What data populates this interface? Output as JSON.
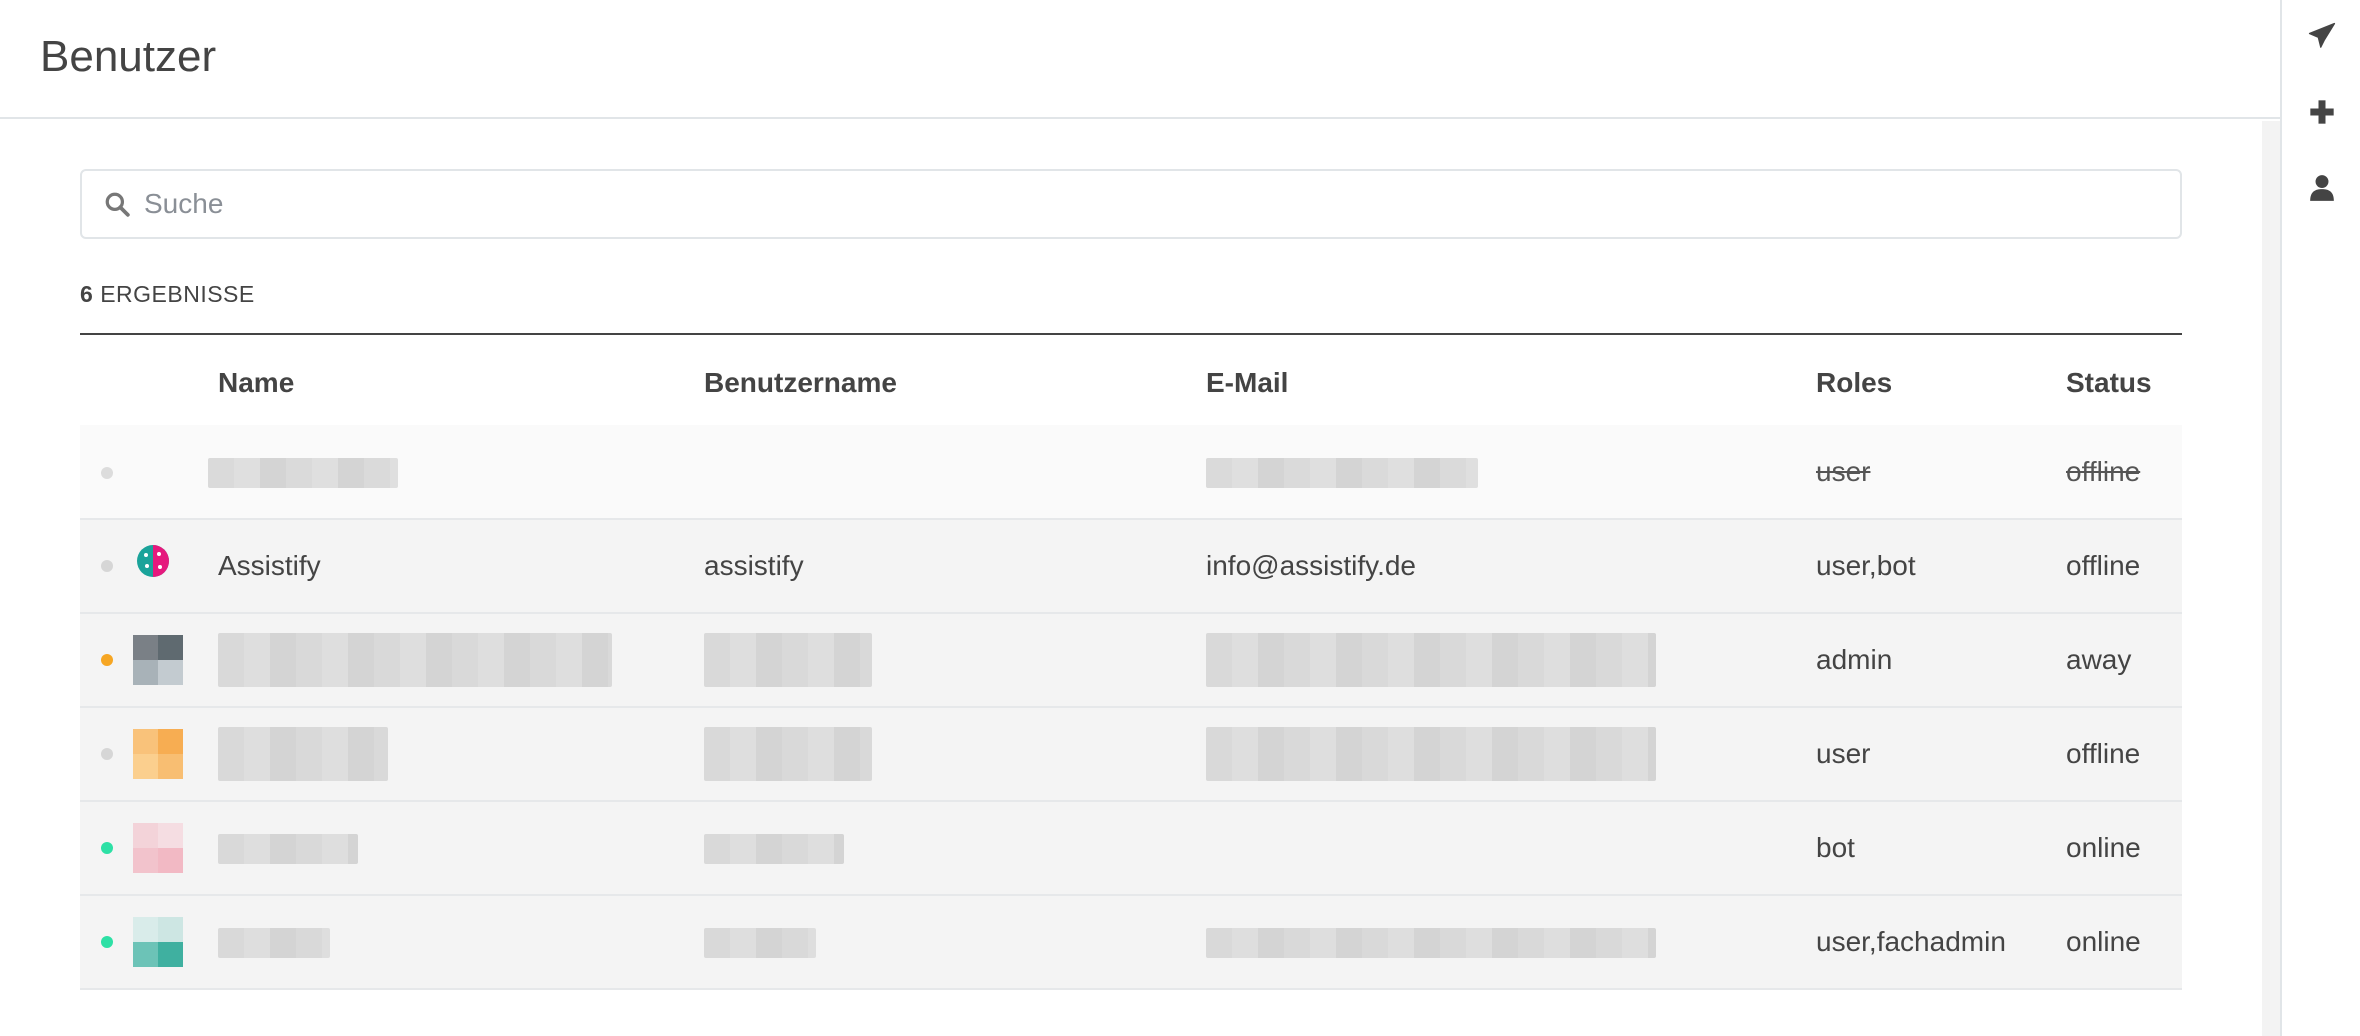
{
  "header": {
    "title": "Benutzer"
  },
  "search": {
    "placeholder": "Suche"
  },
  "results": {
    "count": "6",
    "label": "ERGEBNISSE"
  },
  "table": {
    "columns": [
      "Name",
      "Benutzername",
      "E-Mail",
      "Roles",
      "Status"
    ],
    "rows": [
      {
        "name": "",
        "username": "",
        "email": "",
        "roles": "user",
        "status": "offline",
        "status_color": "#d6d6d6",
        "deactivated": true
      },
      {
        "name": "Assistify",
        "username": "assistify",
        "email": "info@assistify.de",
        "roles": "user,bot",
        "status": "offline",
        "status_color": "#d6d6d6",
        "avatar": "assistify-logo"
      },
      {
        "name": "",
        "username": "",
        "email": "",
        "roles": "admin",
        "status": "away",
        "status_color": "#f6a623",
        "avatar_color": "#5f6a70"
      },
      {
        "name": "",
        "username": "",
        "email": "",
        "roles": "user",
        "status": "offline",
        "status_color": "#d6d6d6",
        "avatar_color": "#f7ad52"
      },
      {
        "name": "",
        "username": "",
        "email": "",
        "roles": "bot",
        "status": "online",
        "status_color": "#2de0a5",
        "avatar_color": "#f2b9c4"
      },
      {
        "name": "",
        "username": "",
        "email": "",
        "roles": "user,fachadmin",
        "status": "online",
        "status_color": "#2de0a5",
        "avatar_color": "#3fb0a0"
      }
    ]
  },
  "right_bar": {
    "icons": [
      "paper-plane-icon",
      "plus-icon",
      "user-icon"
    ]
  },
  "colors": {
    "accent_online": "#2de0a5",
    "accent_away": "#f6a623",
    "offline": "#d6d6d6"
  }
}
